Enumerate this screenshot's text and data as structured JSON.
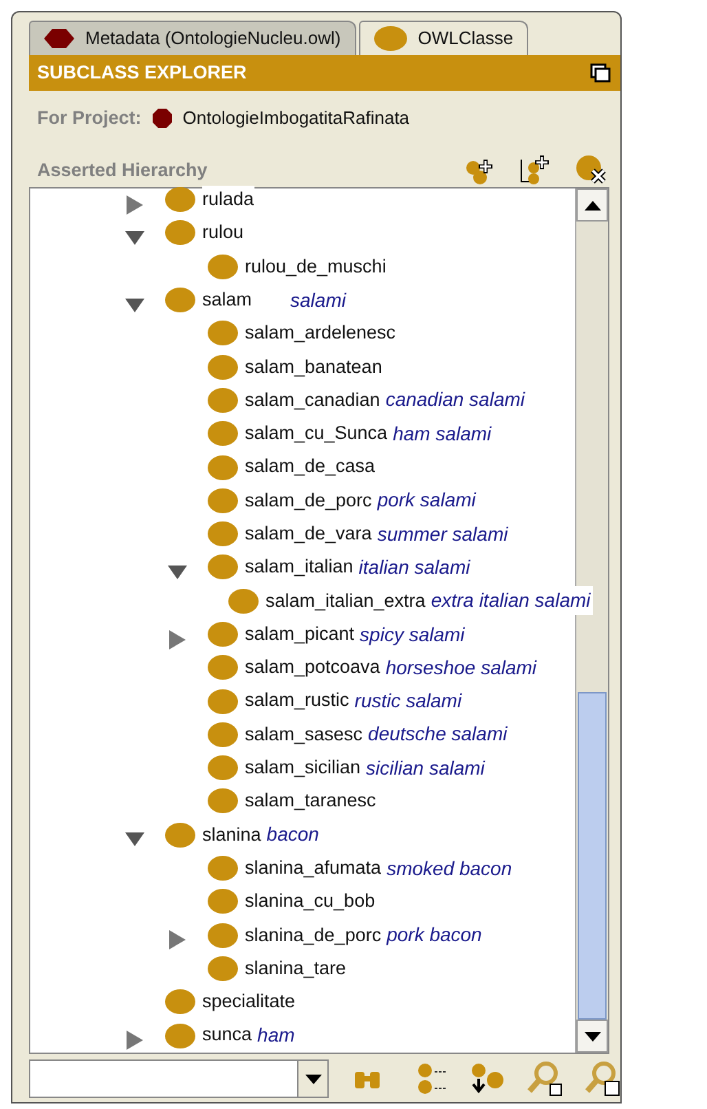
{
  "tabs": [
    {
      "label": "Metadata (OntologieNucleu.owl)",
      "selected": false,
      "kind": "metadata"
    },
    {
      "label": "OWLClasse",
      "selected": true,
      "kind": "class"
    }
  ],
  "panel_title": "SUBCLASS EXPLORER",
  "project": {
    "label": "For Project:",
    "name": "OntologieImbogatitaRafinata"
  },
  "hierarchy_label": "Asserted Hierarchy",
  "tree": [
    {
      "label": "rulada",
      "expanded": false
    },
    {
      "label": "rulou",
      "expanded": true,
      "children": [
        {
          "label": "rulou_de_muschi"
        }
      ]
    },
    {
      "label": "salam",
      "annotation": "salami",
      "expanded": true,
      "children": [
        {
          "label": "salam_ardelenesc"
        },
        {
          "label": "salam_banatean"
        },
        {
          "label": "salam_canadian",
          "annotation": "canadian salami"
        },
        {
          "label": "salam_cu_Sunca",
          "annotation": "ham salami"
        },
        {
          "label": "salam_de_casa"
        },
        {
          "label": "salam_de_porc",
          "annotation": "pork salami"
        },
        {
          "label": "salam_de_vara",
          "annotation": "summer salami"
        },
        {
          "label": "salam_italian",
          "annotation": "italian salami",
          "expanded": true,
          "children": [
            {
              "label": "salam_italian_extra",
              "annotation": "extra italian salami"
            }
          ]
        },
        {
          "label": "salam_picant",
          "annotation": "spicy salami",
          "expanded": false
        },
        {
          "label": "salam_potcoava",
          "annotation": "horseshoe salami"
        },
        {
          "label": "salam_rustic",
          "annotation": "rustic salami"
        },
        {
          "label": "salam_sasesc",
          "annotation": "deutsche salami"
        },
        {
          "label": "salam_sicilian",
          "annotation": "sicilian salami"
        },
        {
          "label": "salam_taranesc"
        }
      ]
    },
    {
      "label": "slanina",
      "annotation": "bacon",
      "expanded": true,
      "children": [
        {
          "label": "slanina_afumata",
          "annotation": "smoked bacon"
        },
        {
          "label": "slanina_cu_bob"
        },
        {
          "label": "slanina_de_porc",
          "annotation": "pork bacon",
          "expanded": false
        },
        {
          "label": "slanina_tare"
        }
      ]
    },
    {
      "label": "specialitate"
    },
    {
      "label": "sunca",
      "annotation": "ham",
      "expanded": false
    }
  ]
}
